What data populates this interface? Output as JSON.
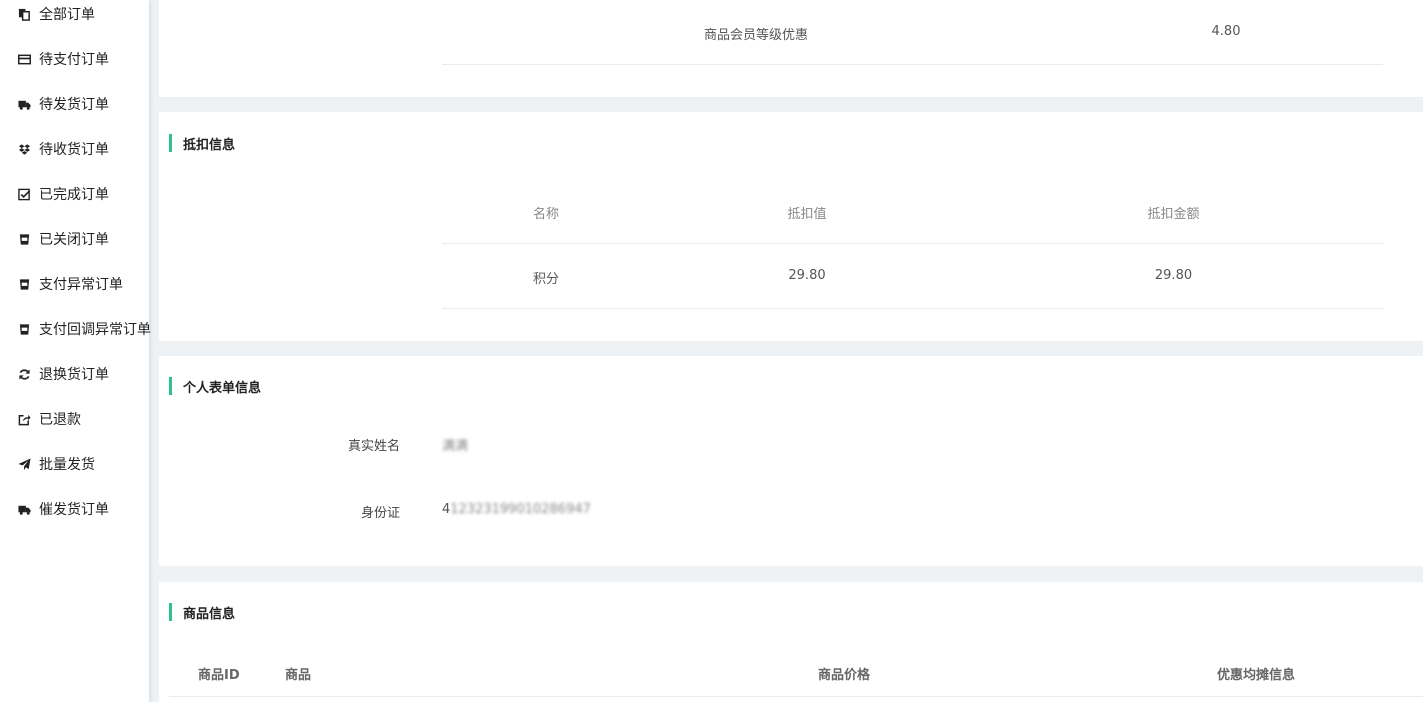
{
  "sidebar": {
    "items": [
      {
        "label": "全部订单",
        "icon": "copy-icon"
      },
      {
        "label": "待支付订单",
        "icon": "credit-card-icon"
      },
      {
        "label": "待发货订单",
        "icon": "truck-icon"
      },
      {
        "label": "待收货订单",
        "icon": "dropbox-icon"
      },
      {
        "label": "已完成订单",
        "icon": "check-square-icon"
      },
      {
        "label": "已关闭订单",
        "icon": "cup-icon"
      },
      {
        "label": "支付异常订单",
        "icon": "cup-icon"
      },
      {
        "label": "支付回调异常订单",
        "icon": "cup-icon"
      },
      {
        "label": "退换货订单",
        "icon": "refresh-icon"
      },
      {
        "label": "已退款",
        "icon": "share-square-icon"
      },
      {
        "label": "批量发货",
        "icon": "paper-plane-icon"
      },
      {
        "label": "催发货订单",
        "icon": "truck-icon"
      }
    ]
  },
  "discount_card": {
    "row_name": "商品会员等级优惠",
    "row_value": "4.80"
  },
  "deduction": {
    "title": "抵扣信息",
    "headers": [
      "名称",
      "抵扣值",
      "抵扣金额"
    ],
    "rows": [
      [
        "积分",
        "29.80",
        "29.80"
      ]
    ]
  },
  "personal_form": {
    "title": "个人表单信息",
    "fields": [
      {
        "label": "真实姓名",
        "value": "满满"
      },
      {
        "label": "身份证",
        "value_prefix": "4",
        "value_masked": "12323199010286947"
      }
    ]
  },
  "goods": {
    "title": "商品信息",
    "headers": [
      "商品ID",
      "商品",
      "商品价格",
      "优惠均摊信息"
    ]
  },
  "colors": {
    "accent": "#2dbf95",
    "background": "#eef2f5"
  }
}
